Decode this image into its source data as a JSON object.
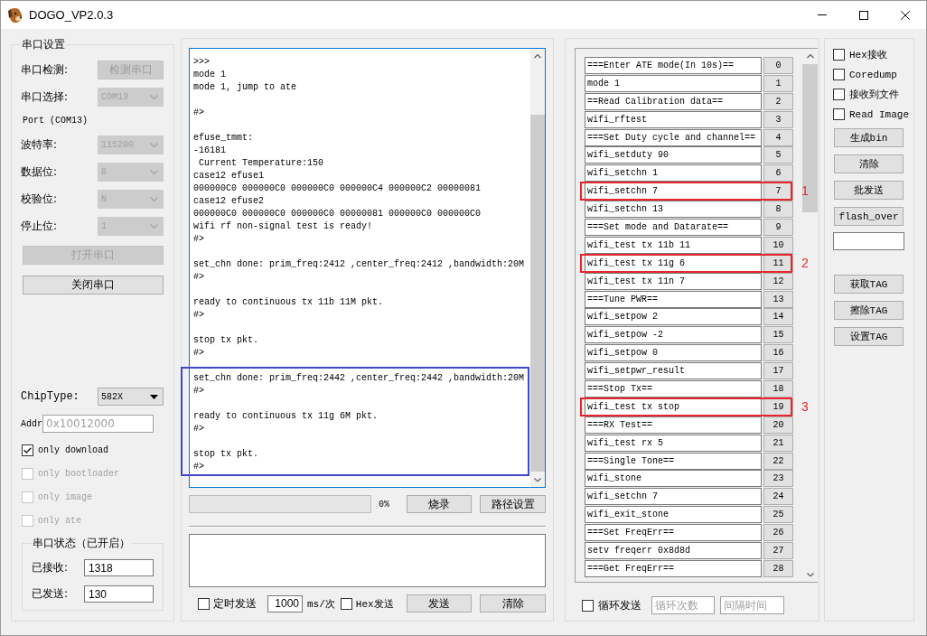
{
  "window": {
    "title": "DOGO_VP2.0.3"
  },
  "serial_settings": {
    "title": "串口设置",
    "rows": [
      {
        "kind": "button",
        "label": "串口检测:",
        "value": "检测串口",
        "disabled": true
      },
      {
        "kind": "select",
        "label": "串口选择:",
        "value": "COM13",
        "disabled": true
      },
      {
        "kind": "note",
        "text": "Port (COM13)"
      },
      {
        "kind": "select",
        "label": "波特率:",
        "value": "115200",
        "disabled": true
      },
      {
        "kind": "select",
        "label": "数据位:",
        "value": "8",
        "disabled": true
      },
      {
        "kind": "select",
        "label": "校验位:",
        "value": "N",
        "disabled": true
      },
      {
        "kind": "select",
        "label": "停止位:",
        "value": "1",
        "disabled": true
      }
    ],
    "port_buttons": [
      {
        "label": "打开串口",
        "disabled": true
      },
      {
        "label": "关闭串口",
        "disabled": false
      }
    ],
    "chip_type": {
      "label": "ChipType:",
      "value": "582X",
      "disabled": false
    },
    "addr": {
      "label": "Addr",
      "placeholder": "0x10012000"
    },
    "options": [
      {
        "label": "only download",
        "checked": true,
        "disabled": false
      },
      {
        "label": "only bootloader",
        "checked": false,
        "disabled": true
      },
      {
        "label": "only image",
        "checked": false,
        "disabled": true
      },
      {
        "label": "only ate",
        "checked": false,
        "disabled": true
      }
    ],
    "status": {
      "title": "串口状态（已开启）",
      "counters": [
        {
          "label": "已接收:",
          "value": "1318"
        },
        {
          "label": "已发送:",
          "value": "130"
        }
      ]
    }
  },
  "console": {
    "sections": [
      {
        "marked": false,
        "blocks": [
          [
            ">>>",
            "mode 1",
            "mode 1, jump to ate"
          ],
          [
            "#>"
          ],
          [
            "efuse_tmmt:",
            "-16181",
            " Current Temperature:150",
            "case12 efuse1",
            "000000C0 000000C0 000000C0 000000C4 000000C2 00000081",
            "case12 efuse2",
            "000000C0 000000C0 000000C0 00000081 000000C0 000000C0",
            "wifi rf non-signal test is ready!",
            "#>"
          ],
          [
            "set_chn done: prim_freq:2412 ,center_freq:2412 ,bandwidth:20M",
            "#>"
          ],
          [
            "ready to continuous tx 11b 11M pkt.",
            "#>"
          ],
          [
            "stop tx pkt.",
            "#>"
          ]
        ]
      },
      {
        "marked": true,
        "blocks": [
          [
            "set_chn done: prim_freq:2442 ,center_freq:2442 ,bandwidth:20M",
            "#>"
          ],
          [
            "ready to continuous tx 11g 6M pkt.",
            "#>"
          ],
          [
            "stop tx pkt.",
            "#>"
          ]
        ]
      }
    ]
  },
  "flash": {
    "level": 0,
    "percent": "0%",
    "buttons": [
      "烧录",
      "路径设置"
    ]
  },
  "send": {
    "timed": {
      "label": "定时发送",
      "checked": false
    },
    "interval": "1000",
    "unit": "ms/次",
    "hex": {
      "label": "Hex发送",
      "checked": false
    },
    "buttons": [
      "发送",
      "清除"
    ]
  },
  "commands": {
    "rows": [
      {
        "command": "===Enter ATE mode(In 10s)==",
        "number": "0"
      },
      {
        "command": "mode 1",
        "number": "1"
      },
      {
        "command": "==Read Calibration data==",
        "number": "2"
      },
      {
        "command": "wifi_rftest",
        "number": "3"
      },
      {
        "command": "===Set Duty cycle and channel==",
        "number": "4"
      },
      {
        "command": "wifi_setduty 90",
        "number": "5"
      },
      {
        "command": "wifi_setchn 1",
        "number": "6"
      },
      {
        "command": "wifi_setchn 7",
        "number": "7",
        "callout": "1"
      },
      {
        "command": "wifi_setchn 13",
        "number": "8"
      },
      {
        "command": "===Set mode and Datarate==",
        "number": "9"
      },
      {
        "command": "wifi_test tx 11b 11",
        "number": "10"
      },
      {
        "command": "wifi_test tx 11g 6",
        "number": "11",
        "callout": "2"
      },
      {
        "command": "wifi_test tx 11n 7",
        "number": "12"
      },
      {
        "command": "===Tune PWR==",
        "number": "13"
      },
      {
        "command": "wifi_setpow 2",
        "number": "14"
      },
      {
        "command": "wifi_setpow -2",
        "number": "15"
      },
      {
        "command": "wifi_setpow 0",
        "number": "16"
      },
      {
        "command": "wifi_setpwr_result",
        "number": "17"
      },
      {
        "command": "===Stop Tx==",
        "number": "18"
      },
      {
        "command": "wifi_test tx stop",
        "number": "19",
        "callout": "3"
      },
      {
        "command": "===RX Test==",
        "number": "20"
      },
      {
        "command": "wifi_test rx 5",
        "number": "21"
      },
      {
        "command": "===Single Tone==",
        "number": "22"
      },
      {
        "command": "wifi_stone",
        "number": "23"
      },
      {
        "command": "wifi_setchn 7",
        "number": "24"
      },
      {
        "command": "wifi_exit_stone",
        "number": "25"
      },
      {
        "command": "===Set FreqErr==",
        "number": "26"
      },
      {
        "command": "setv freqerr 0x8d8d",
        "number": "27"
      },
      {
        "command": "===Get FreqErr==",
        "number": "28"
      }
    ],
    "loop": {
      "label": "循环发送",
      "checked": false
    },
    "count_placeholder": "循环次数",
    "interval_placeholder": "间隔时间"
  },
  "tools": {
    "options": [
      {
        "label": "Hex接收",
        "checked": false
      },
      {
        "label": "Coredump",
        "checked": false
      },
      {
        "label": "接收到文件",
        "checked": false
      },
      {
        "label": "Read Image",
        "checked": false
      }
    ],
    "buttons": [
      "生成bin",
      "清除",
      "批发送",
      "flash_over"
    ],
    "tag_buttons": [
      "获取TAG",
      "擦除TAG",
      "设置TAG"
    ]
  }
}
